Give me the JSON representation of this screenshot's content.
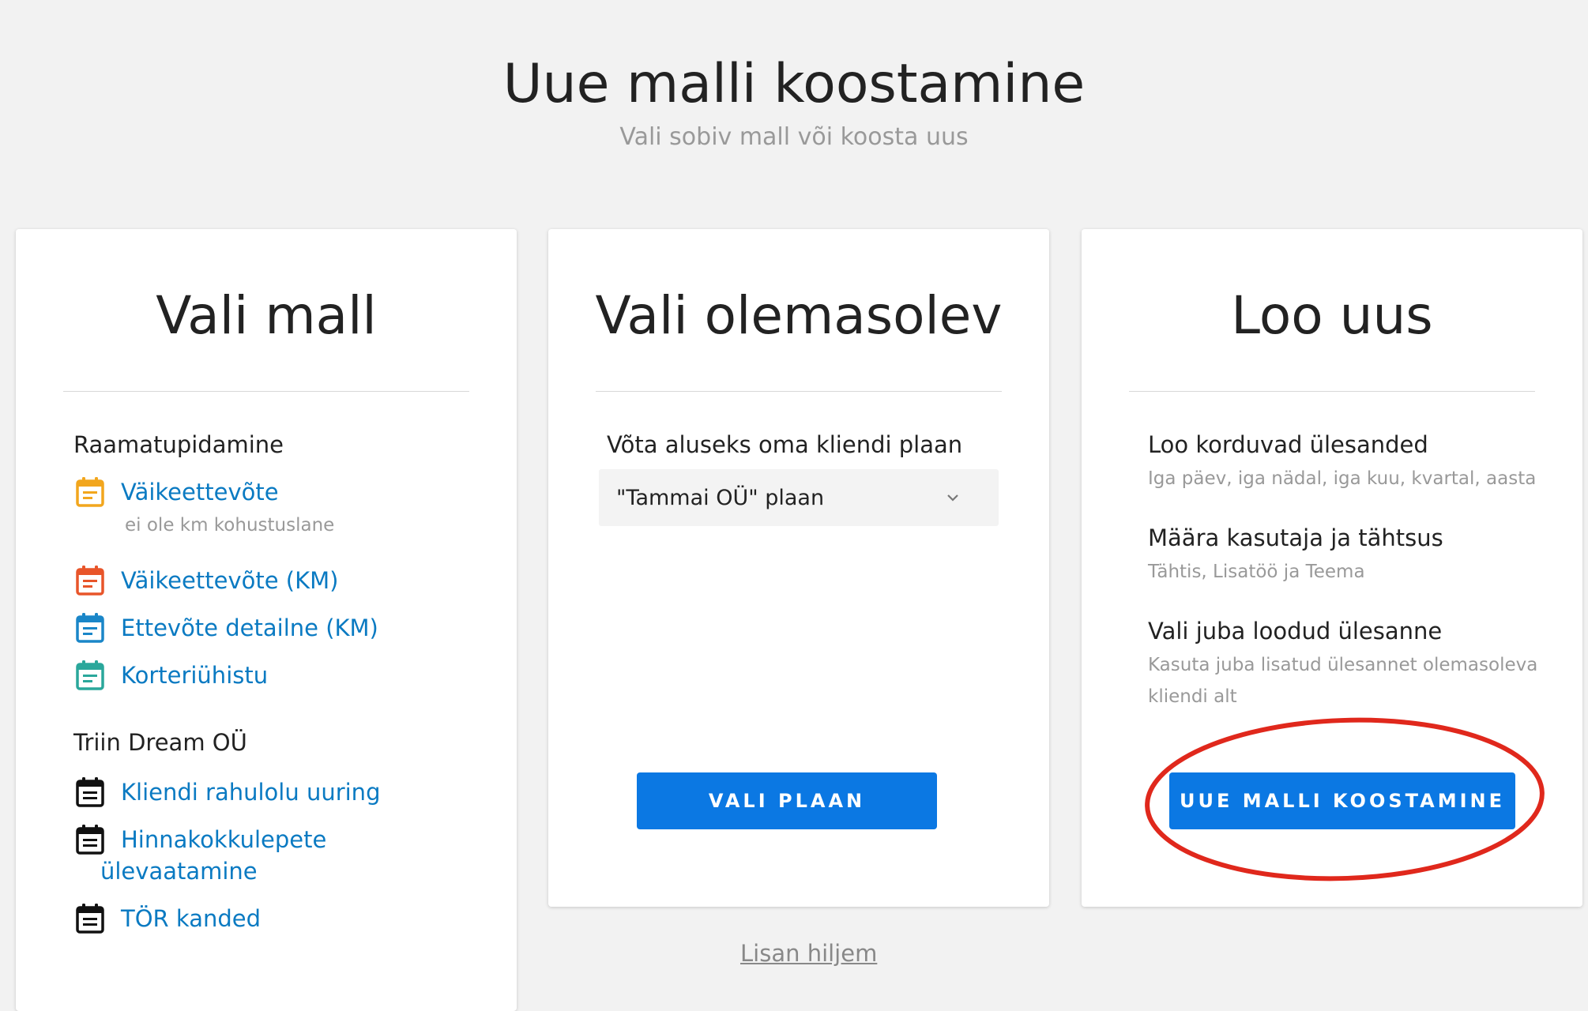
{
  "header": {
    "title": "Uue malli koostamine",
    "subtitle": "Vali sobiv mall või koosta uus"
  },
  "cards": {
    "templates": {
      "title": "Vali mall",
      "groups": [
        {
          "label": "Raamatupidamine",
          "items": [
            {
              "label": "Väikeettevõte",
              "sub": "ei ole km kohustuslane",
              "icon": "calendar-icon",
              "color": "#f2a61d"
            },
            {
              "label": "Väikeettevõte (KM)",
              "icon": "calendar-icon",
              "color": "#e8552a"
            },
            {
              "label": "Ettevõte detailne (KM)",
              "icon": "calendar-icon",
              "color": "#1a86c8"
            },
            {
              "label": "Korteriühistu",
              "icon": "calendar-icon",
              "color": "#2aa79b"
            }
          ]
        },
        {
          "label": "Triin Dream OÜ",
          "items": [
            {
              "label": "Kliendi rahulolu uuring",
              "icon": "calendar-icon",
              "color": "#111111"
            },
            {
              "label": "Hinnakokkulepete",
              "label_cont": "ülevaatamine",
              "icon": "calendar-icon",
              "color": "#111111"
            },
            {
              "label": "TÖR kanded",
              "icon": "calendar-icon",
              "color": "#111111"
            }
          ]
        }
      ]
    },
    "existing": {
      "title": "Vali olemasolev",
      "label": "Võta aluseks oma kliendi plaan",
      "select_value": "\"Tammai OÜ\" plaan",
      "button": "VALI PLAAN"
    },
    "create": {
      "title": "Loo uus",
      "features": [
        {
          "title": "Loo korduvad ülesanded",
          "desc": "Iga päev, iga nädal, iga kuu, kvartal, aasta"
        },
        {
          "title": "Määra kasutaja ja tähtsus",
          "desc": "Tähtis, Lisatöö ja Teema"
        },
        {
          "title": "Vali juba loodud ülesanne",
          "desc": "Kasuta juba lisatud ülesannet olemasoleva kliendi alt"
        }
      ],
      "button": "UUE MALLI KOOSTAMINE"
    }
  },
  "footer": {
    "later_link": "Lisan hiljem"
  },
  "colors": {
    "accent": "#0b78e3",
    "link": "#0a7ac2",
    "annotation": "#e0281c"
  }
}
